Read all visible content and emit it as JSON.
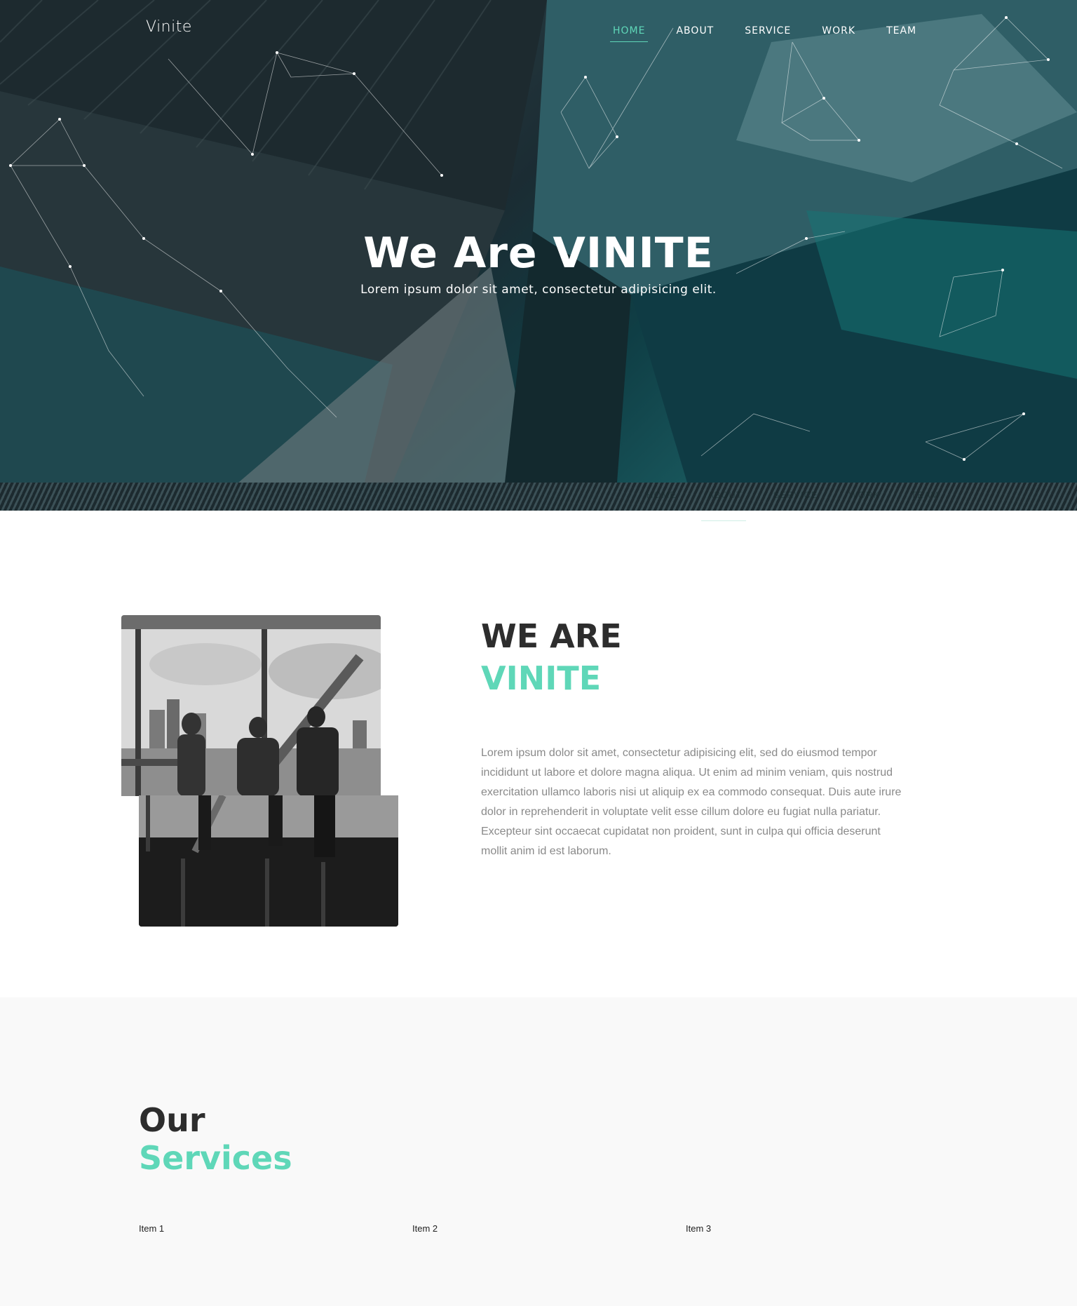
{
  "brand": {
    "logo": "Vinite",
    "accent": "#5fd7b8"
  },
  "nav": {
    "items": [
      "HOME",
      "ABOUT",
      "SERVICE",
      "WORK",
      "TEAM"
    ],
    "active": "HOME"
  },
  "hero": {
    "title": "We Are VINITE",
    "subtitle": "Lorem ipsum dolor sit amet, consectetur adipisicing elit."
  },
  "ghost_nav": [
    "HOME",
    "ABOUT",
    "SERVICE",
    "WORK",
    "TEAM"
  ],
  "about": {
    "heading_line1": "WE ARE",
    "heading_line2": "VINITE",
    "body": "Lorem ipsum dolor sit amet, consectetur adipisicing elit, sed do eiusmod tempor incididunt ut labore et dolore magna aliqua. Ut enim ad minim veniam, quis nostrud exercitation ullamco laboris nisi ut aliquip ex ea commodo consequat. Duis aute irure dolor in reprehenderit in voluptate velit esse cillum dolore eu fugiat nulla pariatur. Excepteur sint occaecat cupidatat non proident, sunt in culpa qui officia deserunt mollit anim id est laborum."
  },
  "services": {
    "heading_line1": "Our",
    "heading_line2": "Services",
    "items": [
      "Item 1",
      "Item 2",
      "Item 3"
    ]
  }
}
